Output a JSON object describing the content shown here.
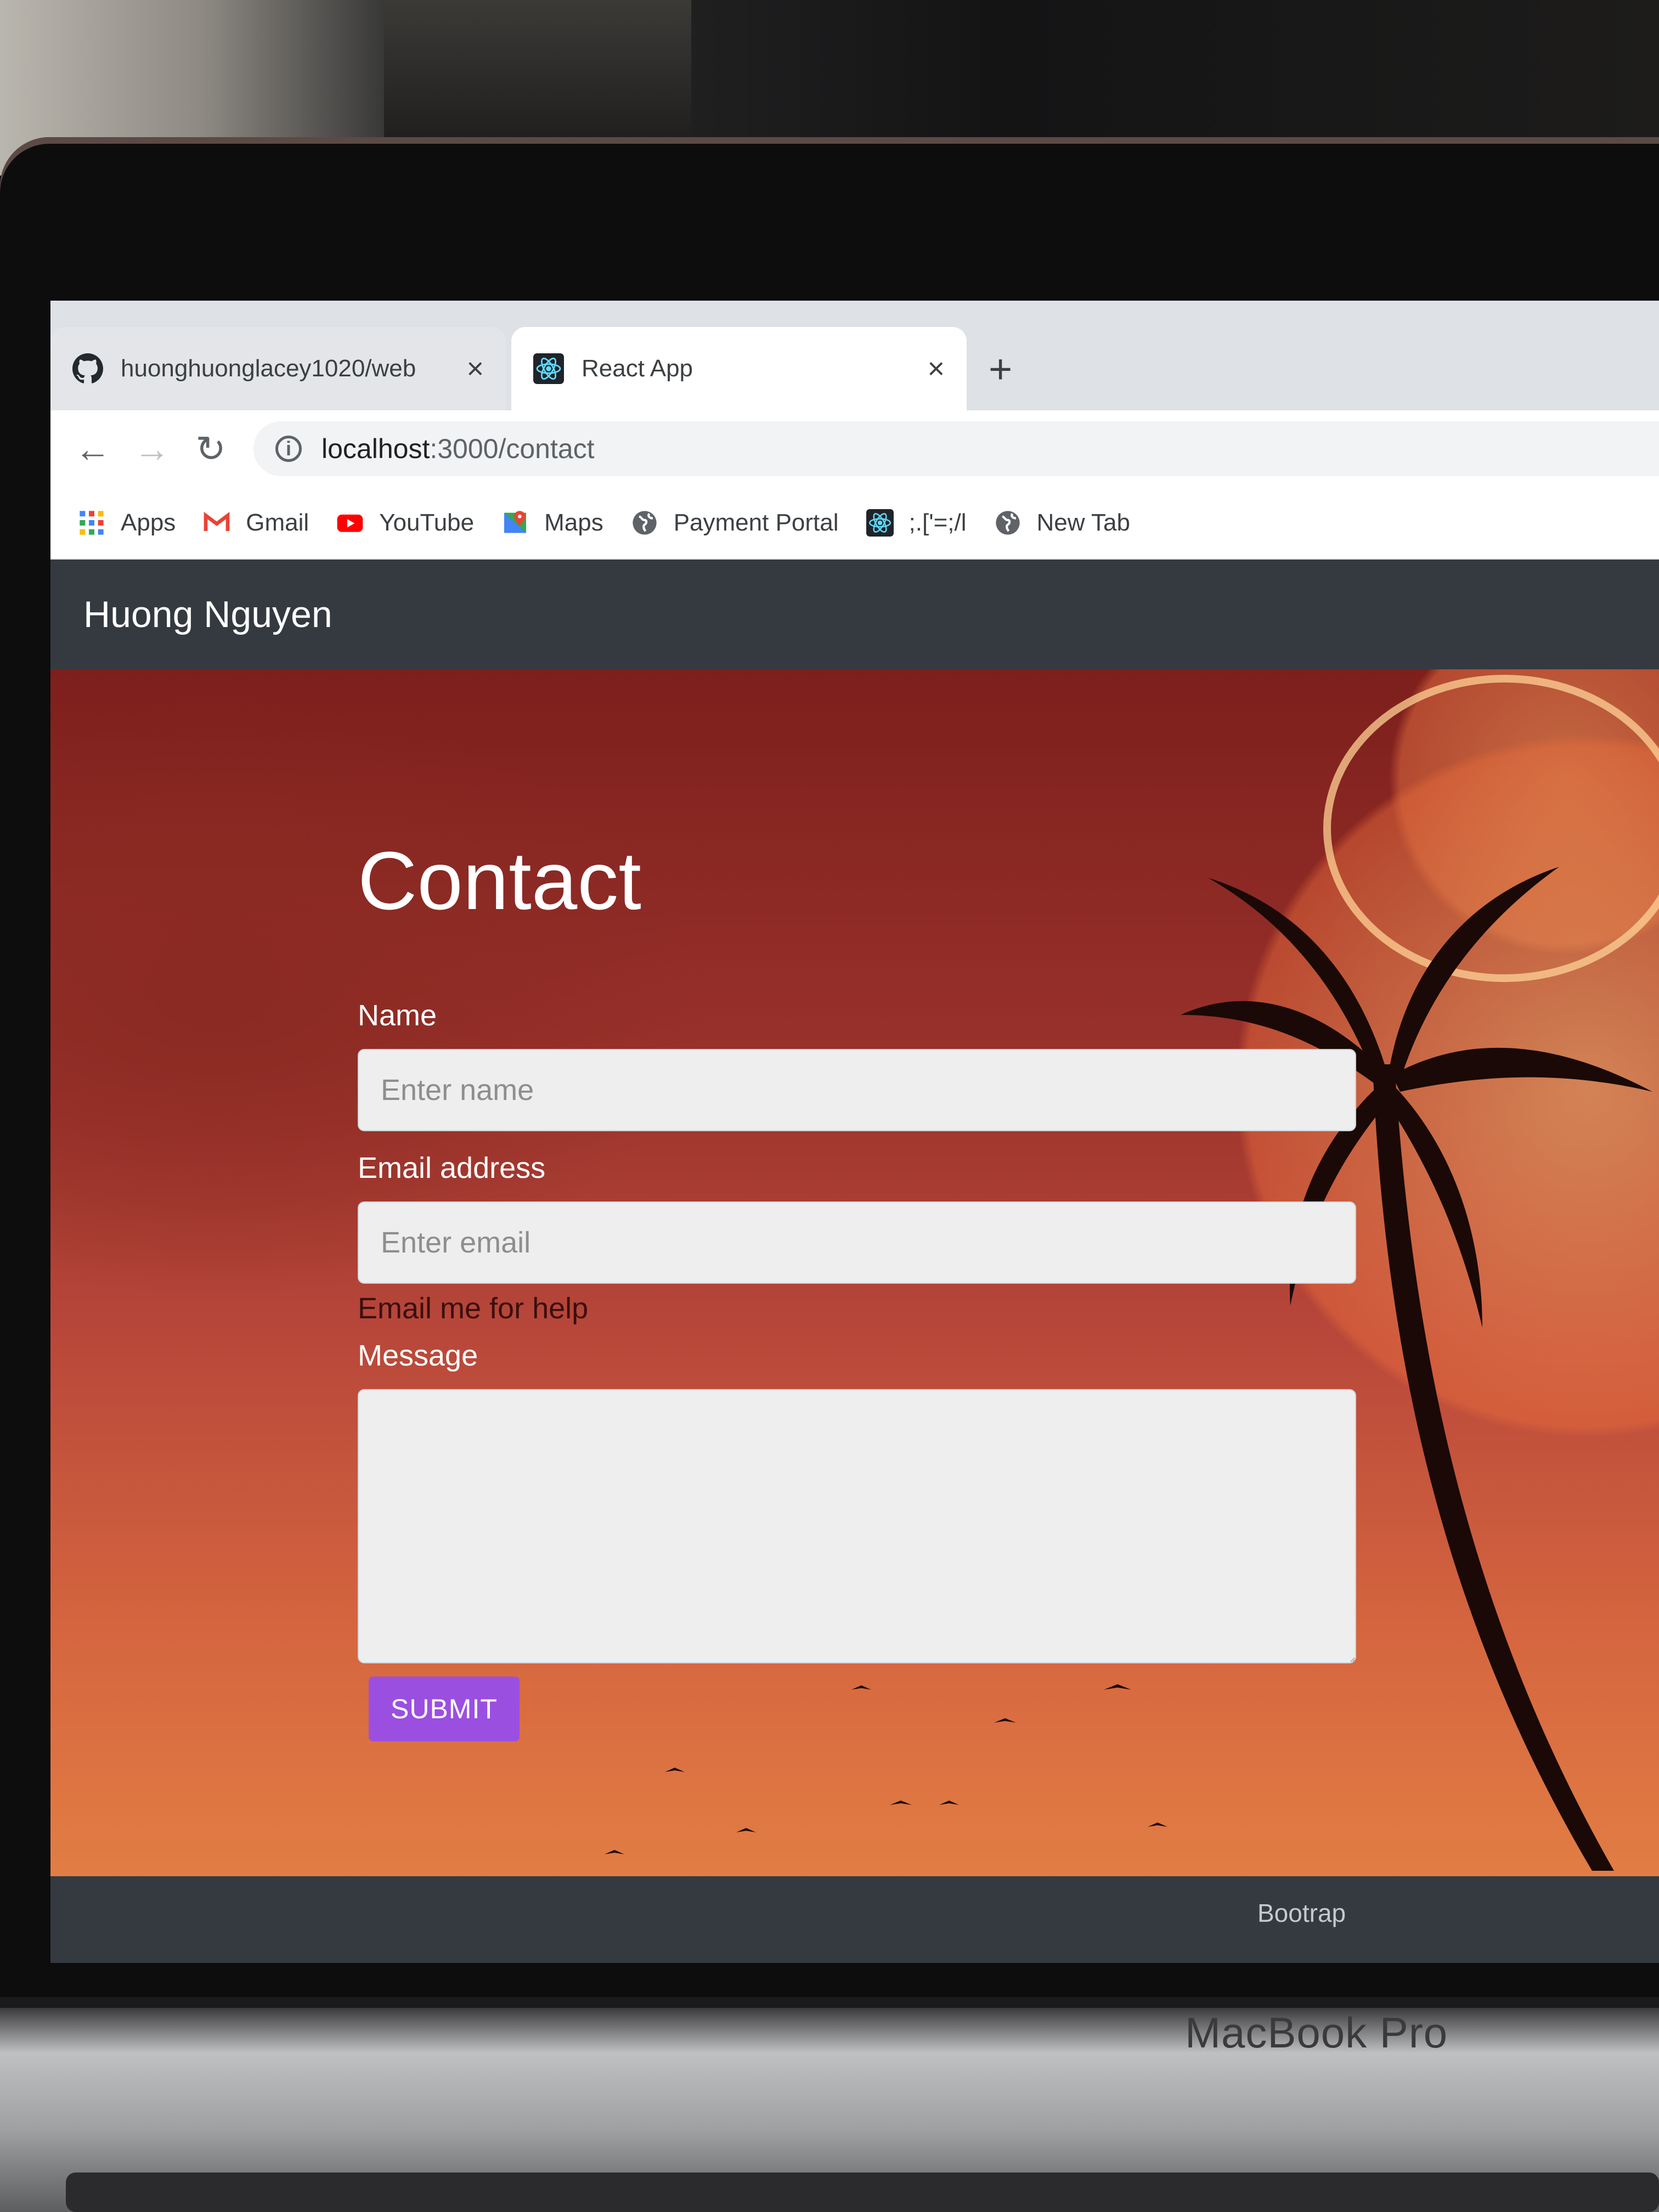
{
  "browser": {
    "tabs": [
      {
        "title": "huonghuonglacey1020/web",
        "icon": "github-icon",
        "active": false
      },
      {
        "title": "React App",
        "icon": "react-icon",
        "active": true
      }
    ],
    "new_tab_label": "+",
    "close_label": "×",
    "url": {
      "host": "localhost",
      "path": ":3000/contact"
    },
    "bookmarks": [
      {
        "label": "Apps",
        "icon": "apps-grid-icon"
      },
      {
        "label": "Gmail",
        "icon": "gmail-icon"
      },
      {
        "label": "YouTube",
        "icon": "youtube-icon"
      },
      {
        "label": "Maps",
        "icon": "maps-icon"
      },
      {
        "label": "Payment Portal",
        "icon": "globe-icon"
      },
      {
        "label": ";.['=;/l",
        "icon": "react-icon"
      },
      {
        "label": "New Tab",
        "icon": "globe-icon"
      }
    ]
  },
  "navbar": {
    "brand": "Huong Nguyen"
  },
  "form": {
    "heading": "Contact",
    "name_label": "Name",
    "name_placeholder": "Enter name",
    "email_label": "Email address",
    "email_placeholder": "Enter email",
    "email_help": "Email me for help",
    "message_label": "Message",
    "submit_label": "SUBMIT"
  },
  "footer": {
    "text": "Bootrap"
  },
  "device": {
    "label": "MacBook Pro"
  },
  "colors": {
    "navbar": "#343a40",
    "submit": "#9b4fe0",
    "hero_top": "#7d1f1c",
    "hero_bottom": "#e27d44"
  }
}
